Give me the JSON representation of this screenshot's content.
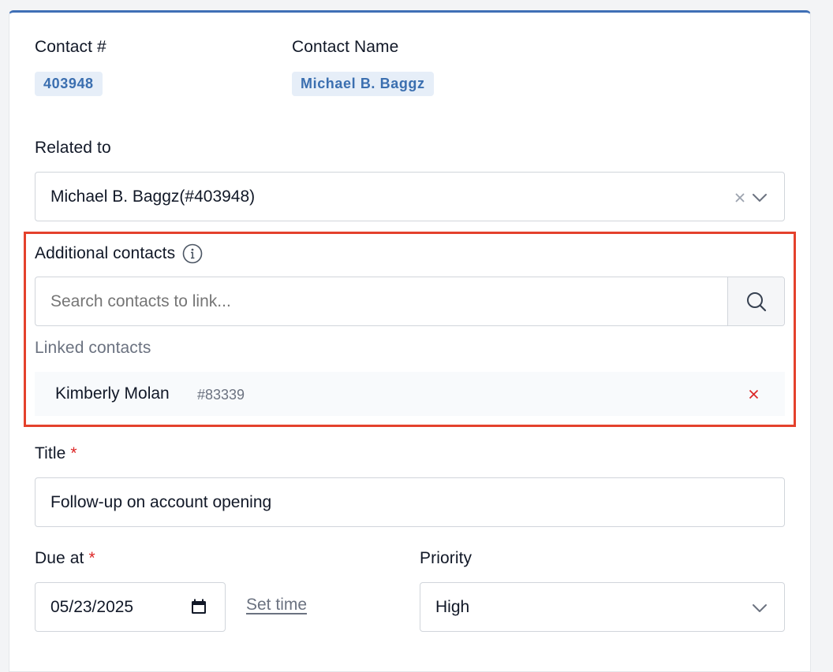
{
  "contact_number": {
    "label": "Contact #",
    "value": "403948"
  },
  "contact_name": {
    "label": "Contact Name",
    "value": "Michael B. Baggz"
  },
  "related_to": {
    "label": "Related to",
    "value": "Michael B. Baggz(#403948)"
  },
  "additional_contacts": {
    "label": "Additional contacts",
    "search_placeholder": "Search contacts to link...",
    "linked_label": "Linked contacts",
    "linked": [
      {
        "name": "Kimberly Molan",
        "id": "#83339"
      }
    ]
  },
  "title_field": {
    "label": "Title",
    "required_mark": "*",
    "value": "Follow-up on account opening"
  },
  "due_at": {
    "label": "Due at",
    "required_mark": "*",
    "value": "05/23/2025",
    "set_time_label": "Set time"
  },
  "priority": {
    "label": "Priority",
    "value": "High"
  },
  "colors": {
    "accent": "#3f6fb6",
    "highlight": "#e4412c",
    "required": "#dc2626",
    "remove": "#dc2626"
  }
}
